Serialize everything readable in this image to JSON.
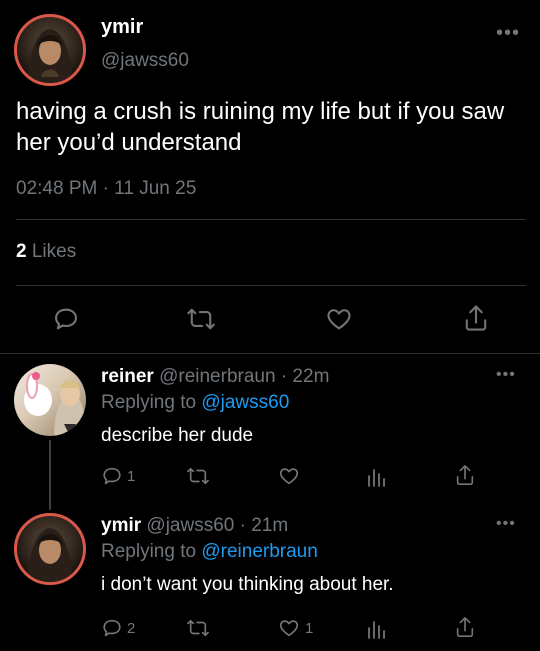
{
  "main_tweet": {
    "name": "ymir",
    "handle": "@jawss60",
    "text": "having a crush is ruining my life but if you saw her you’d understand",
    "timestamp": "02:48 PM · 11 Jun 25",
    "likes_count": "2",
    "likes_label": " Likes"
  },
  "replies": [
    {
      "name": "reiner",
      "meta": " @reinerbraun · 22m",
      "replying_prefix": "Replying to ",
      "replying_to": "@jawss60",
      "text": "describe her dude",
      "reply_count": "1",
      "retweet_count": "",
      "like_count": ""
    },
    {
      "name": "ymir",
      "meta": " @jawss60 · 21m",
      "replying_prefix": "Replying to ",
      "replying_to": "@reinerbraun",
      "text": "i don’t want you thinking about her.",
      "reply_count": "2",
      "retweet_count": "",
      "like_count": "1"
    }
  ],
  "more_glyph": "•••"
}
